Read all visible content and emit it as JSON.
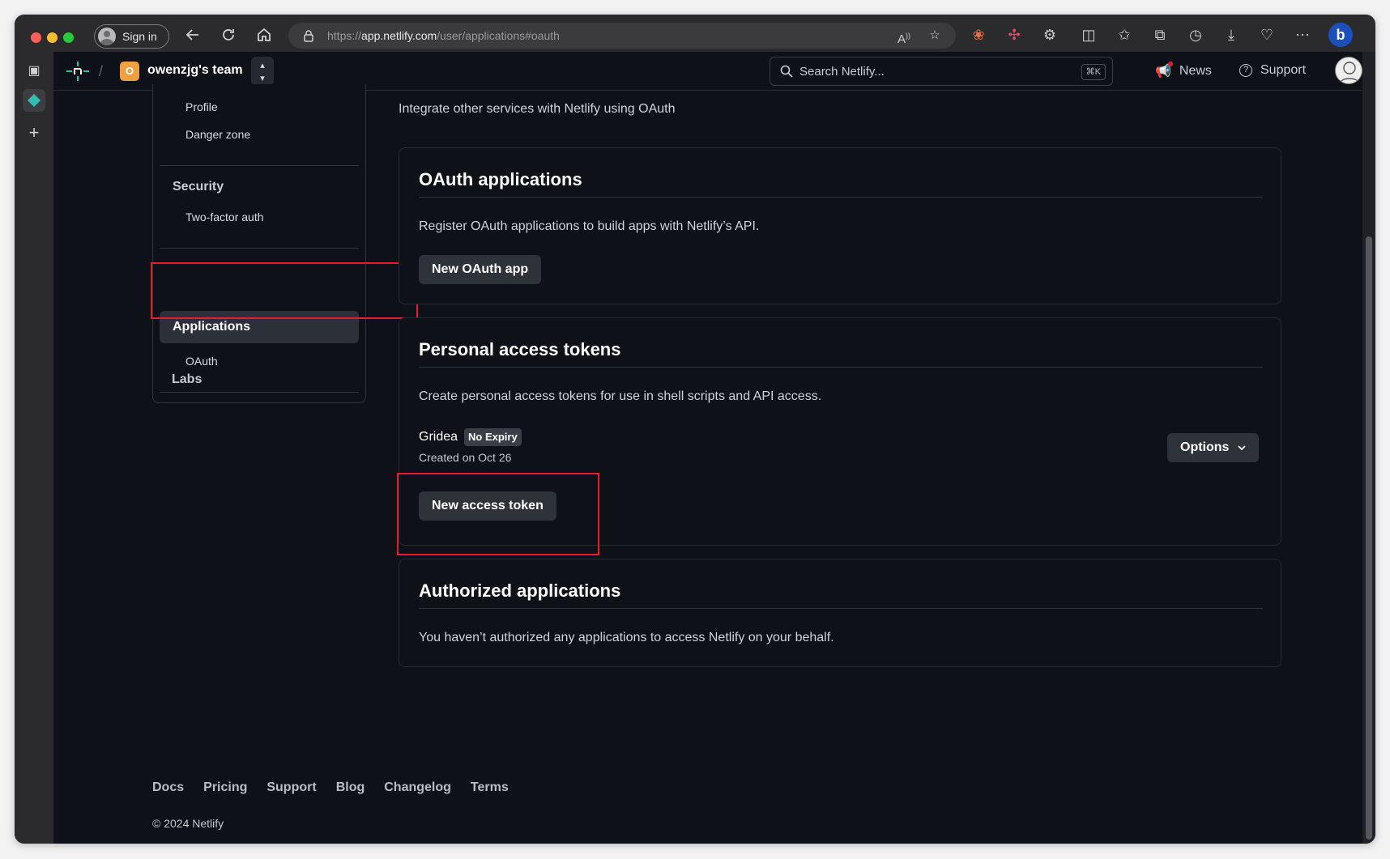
{
  "browser": {
    "signin_label": "Sign in",
    "url_prefix": "https://",
    "url_domain": "app.netlify.com",
    "url_path": "/user/applications#oauth"
  },
  "topbar": {
    "team_initial": "O",
    "team_name": "owenzjg's team",
    "search_placeholder": "Search Netlify...",
    "search_shortcut": "⌘K",
    "news_label": "News",
    "support_label": "Support"
  },
  "sidebar": {
    "profile": "Profile",
    "danger_zone": "Danger zone",
    "security": "Security",
    "two_factor": "Two-factor auth",
    "applications": "Applications",
    "oauth": "OAuth",
    "labs": "Labs"
  },
  "main": {
    "intro": "Integrate other services with Netlify using OAuth",
    "oauth_apps": {
      "title": "OAuth applications",
      "description": "Register OAuth applications to build apps with Netlify’s API.",
      "button": "New OAuth app"
    },
    "tokens": {
      "title": "Personal access tokens",
      "description": "Create personal access tokens for use in shell scripts and API access.",
      "token_name": "Gridea",
      "token_badge": "No Expiry",
      "token_created": "Created on Oct 26",
      "options_label": "Options",
      "button": "New access token"
    },
    "authorized": {
      "title": "Authorized applications",
      "description": "You haven’t authorized any applications to access Netlify on your behalf."
    }
  },
  "footer": {
    "links": [
      "Docs",
      "Pricing",
      "Support",
      "Blog",
      "Changelog",
      "Terms"
    ],
    "copyright": "© 2024 Netlify"
  },
  "colors": {
    "page_bg": "#0e1117",
    "annotation_red": "#e0202a",
    "team_tile": "#f0a040"
  }
}
